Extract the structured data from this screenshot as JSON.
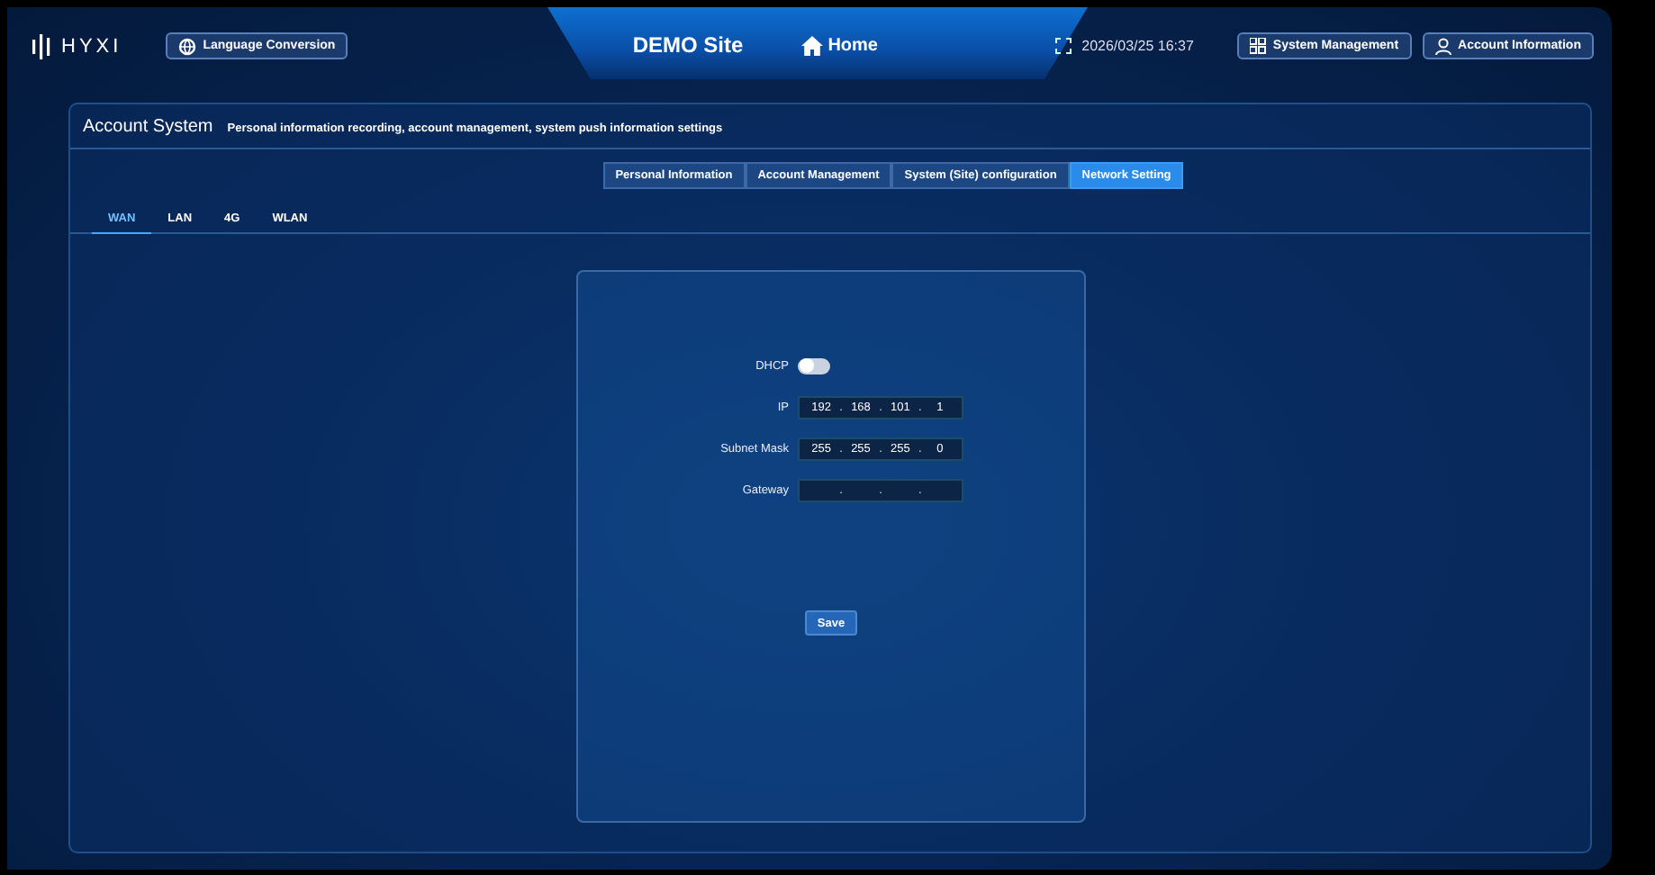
{
  "header": {
    "logo": "HYXI",
    "language_button": "Language Conversion",
    "site_title": "DEMO Site",
    "home_link": "Home",
    "datetime": "2026/03/25 16:37",
    "system_button": "System Management",
    "account_button": "Account Information"
  },
  "panel": {
    "title": "Account System",
    "subtitle": "Personal information recording, account management, system push information settings"
  },
  "tabs": [
    {
      "label": "Personal Information",
      "selected": false
    },
    {
      "label": "Account Management",
      "selected": false
    },
    {
      "label": "System (Site) configuration",
      "selected": false
    },
    {
      "label": "Network Setting",
      "selected": true
    }
  ],
  "subtabs": [
    {
      "label": "WAN",
      "selected": true
    },
    {
      "label": "LAN",
      "selected": false
    },
    {
      "label": "4G",
      "selected": false
    },
    {
      "label": "WLAN",
      "selected": false
    }
  ],
  "form": {
    "rows": [
      {
        "kind": "toggle",
        "label": "DHCP",
        "on": false
      },
      {
        "kind": "ip",
        "label": "IP",
        "separators": [
          ".",
          ".",
          "."
        ],
        "octets": [
          {
            "value": "192"
          },
          {
            "value": "168"
          },
          {
            "value": "101"
          },
          {
            "value": "1"
          }
        ]
      },
      {
        "kind": "ip",
        "label": "Subnet Mask",
        "separators": [
          ".",
          ".",
          "."
        ],
        "octets": [
          {
            "value": "255"
          },
          {
            "value": "255"
          },
          {
            "value": "255"
          },
          {
            "value": "0"
          }
        ]
      },
      {
        "kind": "ip",
        "label": "Gateway",
        "separators": [
          ".",
          ".",
          "."
        ]
      }
    ],
    "save_button": "Save"
  }
}
